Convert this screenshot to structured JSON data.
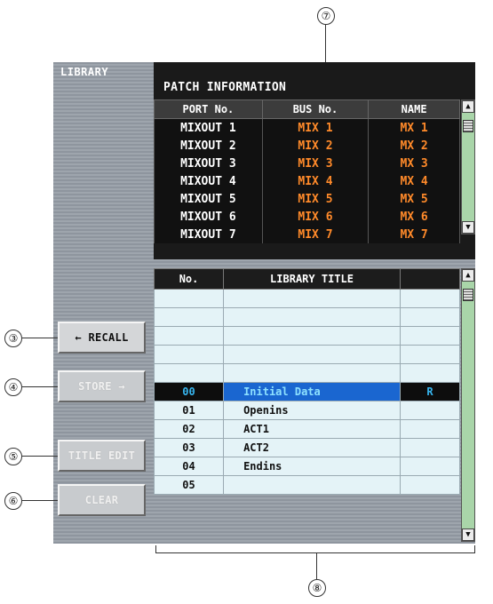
{
  "callouts": {
    "c7": "⑦",
    "c3": "③",
    "c4": "④",
    "c5": "⑤",
    "c6": "⑥",
    "c8": "⑧"
  },
  "library_label": "LIBRARY",
  "patch": {
    "title": "PATCH INFORMATION",
    "headers": [
      "PORT No.",
      "BUS No.",
      "NAME"
    ],
    "rows": [
      {
        "port": "MIXOUT 1",
        "bus": "MIX 1",
        "name": "MX 1"
      },
      {
        "port": "MIXOUT 2",
        "bus": "MIX 2",
        "name": "MX 2"
      },
      {
        "port": "MIXOUT 3",
        "bus": "MIX 3",
        "name": "MX 3"
      },
      {
        "port": "MIXOUT 4",
        "bus": "MIX 4",
        "name": "MX 4"
      },
      {
        "port": "MIXOUT 5",
        "bus": "MIX 5",
        "name": "MX 5"
      },
      {
        "port": "MIXOUT 6",
        "bus": "MIX 6",
        "name": "MX 6"
      },
      {
        "port": "MIXOUT 7",
        "bus": "MIX 7",
        "name": "MX 7"
      }
    ]
  },
  "library": {
    "headers": [
      "No.",
      "LIBRARY TITLE",
      ""
    ],
    "rows": [
      {
        "no": "",
        "title": "",
        "protect": ""
      },
      {
        "no": "",
        "title": "",
        "protect": ""
      },
      {
        "no": "",
        "title": "",
        "protect": ""
      },
      {
        "no": "",
        "title": "",
        "protect": ""
      },
      {
        "no": "",
        "title": "",
        "protect": ""
      },
      {
        "no": "00",
        "title": "Initial Data",
        "protect": "R"
      },
      {
        "no": "01",
        "title": "Openins",
        "protect": ""
      },
      {
        "no": "02",
        "title": "ACT1",
        "protect": ""
      },
      {
        "no": "03",
        "title": "ACT2",
        "protect": ""
      },
      {
        "no": "04",
        "title": "Endins",
        "protect": ""
      },
      {
        "no": "05",
        "title": "",
        "protect": ""
      }
    ],
    "selected_index": 5
  },
  "buttons": {
    "recall": "← RECALL",
    "store": "STORE →",
    "title_edit": "TITLE EDIT",
    "clear": "CLEAR"
  },
  "icons": {
    "scroll_up": "▲",
    "scroll_down": "▼"
  },
  "colors": {
    "bus_name_text": "#ff8a2a",
    "selected_number": "#37b6f0",
    "selected_title_bg": "#1a66d0",
    "list_bg": "#e4f3f7",
    "scrollbar": "#a9d5a9"
  }
}
